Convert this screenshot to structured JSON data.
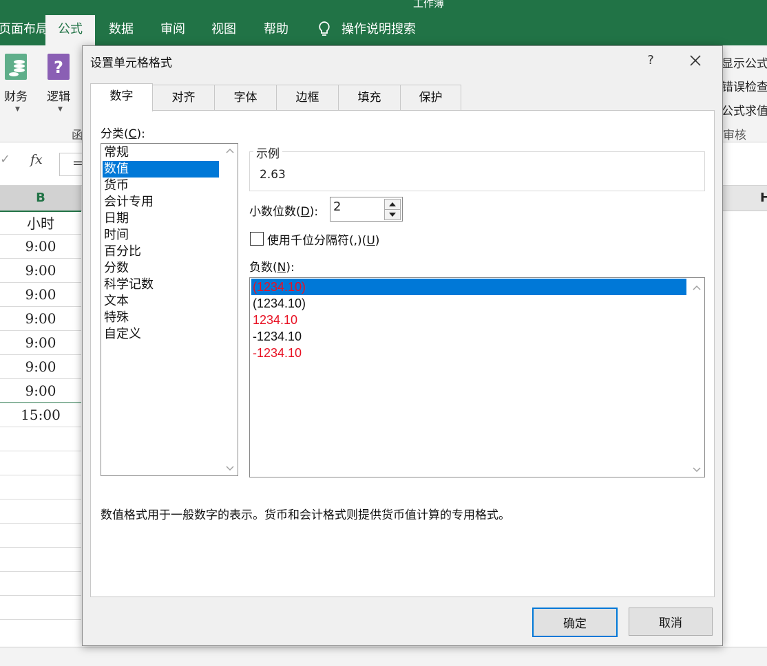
{
  "window": {
    "title": "工作簿"
  },
  "ribbon": {
    "tabs": [
      {
        "label": "页面布局"
      },
      {
        "label": "公式"
      },
      {
        "label": "数据"
      },
      {
        "label": "审阅"
      },
      {
        "label": "视图"
      },
      {
        "label": "帮助"
      }
    ],
    "tell_me": "操作说明搜索",
    "buttons": [
      {
        "label": "财务",
        "icon": "coins-book-icon"
      },
      {
        "label": "逻辑",
        "icon": "question-book-icon"
      }
    ],
    "group_label": "函",
    "right_items": [
      "显示公式",
      "错误检查",
      "公式求值"
    ],
    "right_group_label": "审核"
  },
  "formula_bar": {
    "fx": "fx",
    "equals": "="
  },
  "sheet": {
    "col_b": "B",
    "col_h": "H",
    "cells": [
      "小时",
      "9:00",
      "9:00",
      "9:00",
      "9:00",
      "9:00",
      "9:00",
      "9:00",
      "15:00"
    ]
  },
  "dialog": {
    "title": "设置单元格格式",
    "help": "?",
    "tabs": [
      "数字",
      "对齐",
      "字体",
      "边框",
      "填充",
      "保护"
    ],
    "category_label": "分类(",
    "category_key": "C",
    "category_label_end": "):",
    "categories": [
      "常规",
      "数值",
      "货币",
      "会计专用",
      "日期",
      "时间",
      "百分比",
      "分数",
      "科学记数",
      "文本",
      "特殊",
      "自定义"
    ],
    "selected_category_index": 1,
    "sample_label": "示例",
    "sample_value": "2.63",
    "decimal_label": "小数位数(",
    "decimal_key": "D",
    "decimal_label_end": "):",
    "decimal_value": "2",
    "thousand_label": "使用千位分隔符(,)(",
    "thousand_key": "U",
    "thousand_label_end": ")",
    "thousand_checked": false,
    "negative_label": "负数(",
    "negative_key": "N",
    "negative_label_end": "):",
    "negative_numbers": [
      {
        "text": "(1234.10)",
        "color": "#e81123"
      },
      {
        "text": "(1234.10)",
        "color": "#111111"
      },
      {
        "text": "1234.10",
        "color": "#e81123"
      },
      {
        "text": "-1234.10",
        "color": "#111111"
      },
      {
        "text": "-1234.10",
        "color": "#e81123"
      }
    ],
    "selected_negative_index": 0,
    "description": "数值格式用于一般数字的表示。货币和会计格式则提供货币值计算的专用格式。",
    "ok_label": "确定",
    "cancel_label": "取消"
  },
  "colors": {
    "excel_green": "#217346",
    "selection_blue": "#0078d7"
  }
}
